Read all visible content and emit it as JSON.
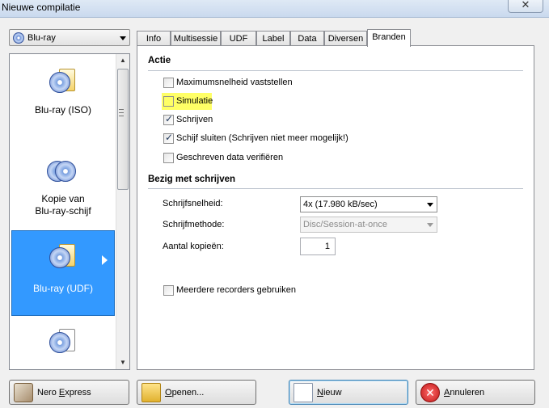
{
  "window": {
    "title": "Nieuwe compilatie",
    "close_glyph": "✕"
  },
  "disc_type_combo": {
    "value": "Blu-ray",
    "icon": "disc-icon"
  },
  "compilation_types": [
    {
      "label": "Blu-ray (ISO)",
      "icon": "bluray-iso-icon",
      "selected": false
    },
    {
      "label": "Kopie van Blu-ray-schijf",
      "label_line1": "Kopie van",
      "label_line2": "Blu-ray-schijf",
      "icon": "bluray-copy-icon",
      "selected": false
    },
    {
      "label": "Blu-ray (UDF)",
      "icon": "bluray-udf-icon",
      "selected": true
    },
    {
      "label": "",
      "icon": "bluray-video-icon",
      "selected": false
    }
  ],
  "tabs": [
    "Info",
    "Multisessie",
    "UDF",
    "Label",
    "Data",
    "Diversen",
    "Branden"
  ],
  "active_tab": "Branden",
  "actie": {
    "title": "Actie",
    "options": [
      {
        "label": "Maximumsnelheid vaststellen",
        "checked": false,
        "highlighted": false
      },
      {
        "label": "Simulatie",
        "checked": false,
        "highlighted": true
      },
      {
        "label": "Schrijven",
        "checked": true,
        "highlighted": false
      },
      {
        "label": "Schijf sluiten (Schrijven niet meer mogelijk!)",
        "checked": true,
        "highlighted": false
      },
      {
        "label": "Geschreven data verifiëren",
        "checked": false,
        "highlighted": false
      }
    ]
  },
  "writing": {
    "title": "Bezig met schrijven",
    "speed_label": "Schrijfsnelheid:",
    "speed_value": "4x (17.980 kB/sec)",
    "method_label": "Schrijfmethode:",
    "method_value": "Disc/Session-at-once",
    "copies_label": "Aantal kopieën:",
    "copies_value": "1",
    "multi_recorder_label": "Meerdere recorders gebruiken",
    "multi_recorder_checked": false
  },
  "buttons": {
    "nero_express": {
      "pre": "Nero ",
      "acc": "E",
      "post": "xpress"
    },
    "openen": {
      "pre": "",
      "acc": "O",
      "post": "penen..."
    },
    "nieuw": {
      "pre": "",
      "acc": "N",
      "post": "ieuw"
    },
    "annuleren": {
      "pre": "",
      "acc": "A",
      "post": "nnuleren"
    }
  },
  "colors": {
    "selection": "#3399ff",
    "highlight": "#ffff66"
  }
}
